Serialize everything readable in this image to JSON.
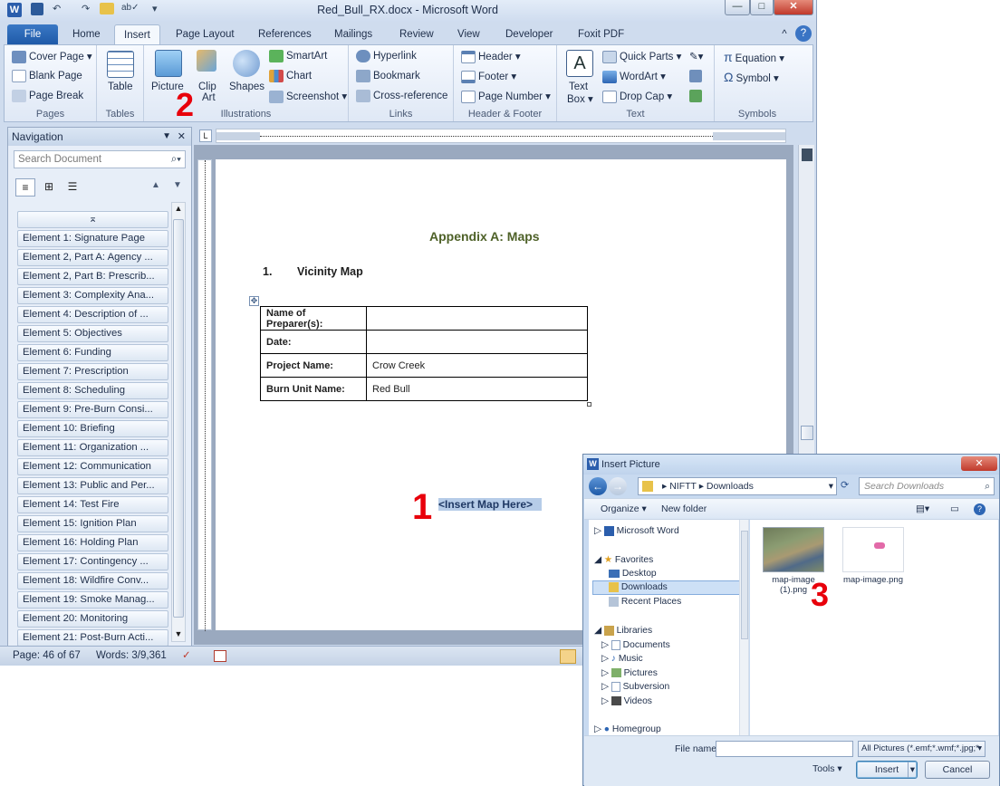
{
  "titlebar": {
    "title": "Red_Bull_RX.docx - Microsoft Word",
    "qat_app_letter": "W"
  },
  "tabs": [
    "File",
    "Home",
    "Insert",
    "Page Layout",
    "References",
    "Mailings",
    "Review",
    "View",
    "Developer",
    "Foxit PDF"
  ],
  "ribbon": {
    "pages": {
      "label": "Pages",
      "items": [
        "Cover Page ▾",
        "Blank Page",
        "Page Break"
      ]
    },
    "tables": {
      "label": "Tables",
      "item": "Table"
    },
    "illustrations": {
      "label": "Illustrations",
      "picture": "Picture",
      "clip": "Clip",
      "art": "Art",
      "shapes": "Shapes",
      "smartart": "SmartArt",
      "chart": "Chart",
      "screenshot": "Screenshot ▾"
    },
    "links": {
      "label": "Links",
      "items": [
        "Hyperlink",
        "Bookmark",
        "Cross-reference"
      ]
    },
    "header_footer": {
      "label": "Header & Footer",
      "items": [
        "Header ▾",
        "Footer ▾",
        "Page Number ▾"
      ]
    },
    "text": {
      "label": "Text",
      "textbox1": "Text",
      "textbox2": "Box ▾",
      "items": [
        "Quick Parts ▾",
        "WordArt ▾",
        "Drop Cap ▾"
      ]
    },
    "symbols": {
      "label": "Symbols",
      "items": [
        "Equation ▾",
        "Symbol ▾"
      ]
    }
  },
  "markers": {
    "one": "1",
    "two": "2",
    "three": "3"
  },
  "navigation": {
    "title": "Navigation",
    "search_placeholder": "Search Document",
    "items": [
      "Element 1: Signature Page",
      "Element 2, Part A: Agency ...",
      "Element 2, Part B: Prescrib...",
      "Element 3: Complexity Ana...",
      "Element 4: Description of ...",
      "Element 5: Objectives",
      "Element 6: Funding",
      "Element 7: Prescription",
      "Element 8: Scheduling",
      "Element 9: Pre-Burn Consi...",
      "Element 10: Briefing",
      "Element 11: Organization ...",
      "Element 12: Communication",
      "Element 13: Public and Per...",
      "Element 14: Test Fire",
      "Element 15: Ignition Plan",
      "Element 16: Holding Plan",
      "Element 17: Contingency ...",
      "Element 18: Wildfire Conv...",
      "Element 19: Smoke Manag...",
      "Element 20: Monitoring",
      "Element 21: Post-Burn Acti..."
    ]
  },
  "document": {
    "heading": "Appendix A: Maps",
    "section_number": "1.",
    "section_title": "Vicinity Map",
    "table": [
      {
        "key": "Name of Preparer(s):",
        "value": ""
      },
      {
        "key": "Date:",
        "value": ""
      },
      {
        "key": "Project Name:",
        "value": "Crow Creek"
      },
      {
        "key": "Burn Unit Name:",
        "value": "Red Bull"
      }
    ],
    "placeholder": "<Insert Map Here>"
  },
  "statusbar": {
    "page": "Page: 46 of 67",
    "words": "Words: 3/9,361"
  },
  "dialog": {
    "title": "Insert Picture",
    "path": [
      "NIFTT",
      "Downloads"
    ],
    "search_placeholder": "Search Downloads",
    "organize": "Organize ▾",
    "new_folder": "New folder",
    "tree": {
      "microsoft_word": "Microsoft Word",
      "favorites": "Favorites",
      "desktop": "Desktop",
      "downloads": "Downloads",
      "recent": "Recent Places",
      "libraries": "Libraries",
      "documents": "Documents",
      "music": "Music",
      "pictures": "Pictures",
      "subversion": "Subversion",
      "videos": "Videos",
      "homegroup": "Homegroup"
    },
    "files": [
      {
        "name1": "map-image",
        "name2": "(1).png"
      },
      {
        "name1": "map-image.png",
        "name2": ""
      }
    ],
    "filename_label": "File name:",
    "filename_value": "",
    "filter": "All Pictures (*.emf;*.wmf;*.jpg;*",
    "tools": "Tools",
    "insert": "Insert",
    "cancel": "Cancel"
  }
}
